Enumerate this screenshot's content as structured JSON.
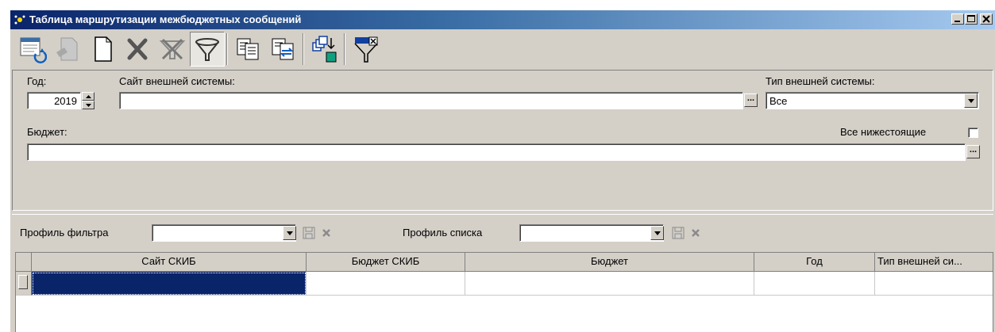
{
  "window": {
    "title": "Таблица маршрутизации межбюджетных сообщений"
  },
  "toolbar": {
    "buttons": [
      "refresh-icon",
      "edit-document-icon",
      "new-document-icon",
      "delete-icon",
      "clear-filter-icon",
      "filter-icon",
      "copy-icon",
      "copy-link-icon",
      "export-icon",
      "close-filter-icon"
    ],
    "filter_pressed": true
  },
  "filter": {
    "year_label": "Год:",
    "year_value": "2019",
    "site_label": "Сайт внешней системы:",
    "site_value": "",
    "type_label": "Тип внешней системы:",
    "type_value": "Все",
    "budget_label": "Бюджет:",
    "budget_value": "",
    "all_lower_label": "Все нижестоящие",
    "ellipsis": "..."
  },
  "profiles": {
    "filter_label": "Профиль фильтра",
    "filter_value": "",
    "list_label": "Профиль списка",
    "list_value": ""
  },
  "table": {
    "columns": [
      "Сайт СКИБ",
      "Бюджет СКИБ",
      "Бюджет",
      "Год",
      "Тип внешней си..."
    ],
    "selected_color": "#0a246a"
  }
}
